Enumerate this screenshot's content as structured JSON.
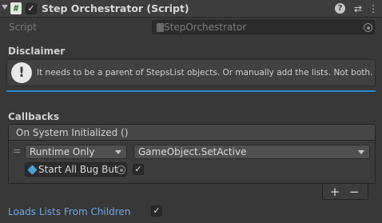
{
  "header": {
    "title": "Step Orchestrator (Script)",
    "script_icon_glyph": "#",
    "enabled_check": "✓",
    "help_glyph": "?",
    "presets_glyph": "⇄",
    "menu_glyph": "⋮"
  },
  "script_field": {
    "label": "Script",
    "value": "StepOrchestrator"
  },
  "disclaimer": {
    "title": "Disclaimer",
    "icon_glyph": "!",
    "message": "It needs to be a parent of StepsList objects. Or manually add the lists. Not both."
  },
  "callbacks": {
    "title": "Callbacks",
    "event_name": "On System Initialized ()",
    "listener": {
      "runtime_mode": "Runtime Only",
      "function": "GameObject.SetActive",
      "target_object": "Start All Bug But",
      "argument_check": "✓"
    },
    "add_label": "+",
    "remove_label": "−"
  },
  "loads_lists": {
    "label": "Loads Lists From Children",
    "check": "✓"
  },
  "colors": {
    "background": "#383838",
    "accent_divider": "#2a87c8",
    "highlight_label": "#6fa6e6"
  }
}
